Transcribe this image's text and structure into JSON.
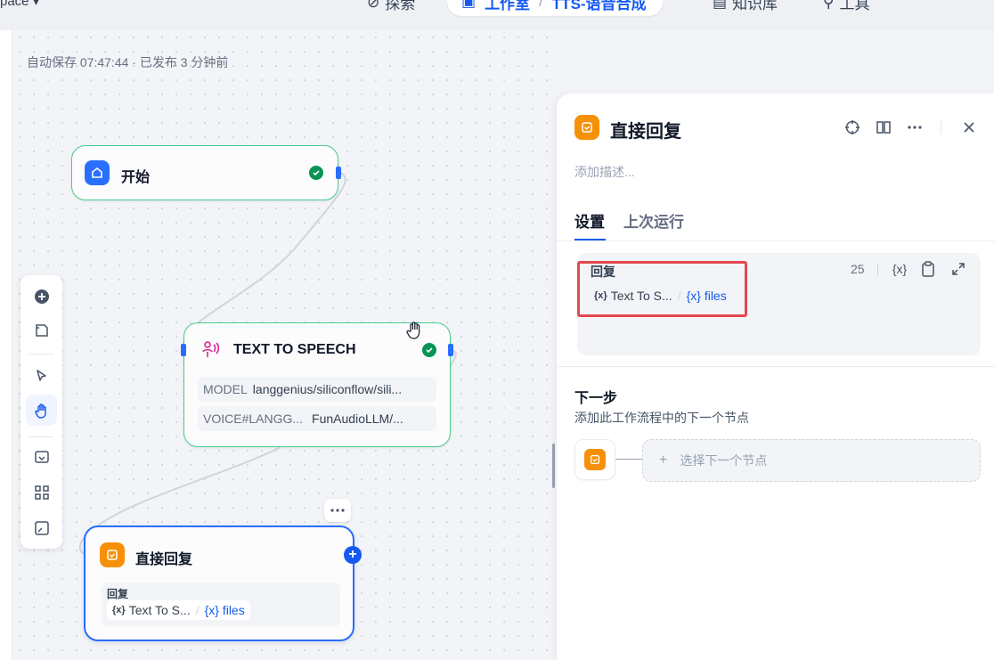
{
  "topnav": {
    "workspace": "pace",
    "explore": "探索",
    "studio": "工作室",
    "app_name": "TTS-语音合成",
    "knowledge": "知识库",
    "tools": "工具"
  },
  "canvas": {
    "autosave": "自动保存 07:47:44 · 已发布 3 分钟前"
  },
  "nodes": {
    "start": {
      "title": "开始"
    },
    "tts": {
      "title": "TEXT TO SPEECH",
      "model_key": "MODEL",
      "model_value": "langgenius/siliconflow/sili...",
      "voice_key": "VOICE#LANGG...",
      "voice_value": "FunAudioLLM/..."
    },
    "answer": {
      "title": "直接回复",
      "reply_label": "回复",
      "var_prefix": "{x}",
      "var_node": "Text To S...",
      "var_sep": "/",
      "var_name": "{x} files"
    }
  },
  "panel": {
    "title": "直接回复",
    "description_placeholder": "添加描述...",
    "tabs": [
      "设置",
      "上次运行"
    ],
    "reply_label": "回复",
    "reply_count": "25",
    "var_tool": "{x}",
    "var_prefix": "{x}",
    "var_node": "Text To S...",
    "var_sep": "/",
    "var_name": "{x} files",
    "next_title": "下一步",
    "next_desc": "添加此工作流程中的下一个节点",
    "next_select": "选择下一个节点"
  },
  "colors": {
    "accent": "#155aef",
    "success_border": "#47cd89",
    "answer_icon": "#f79009",
    "highlight": "#e5484d"
  }
}
